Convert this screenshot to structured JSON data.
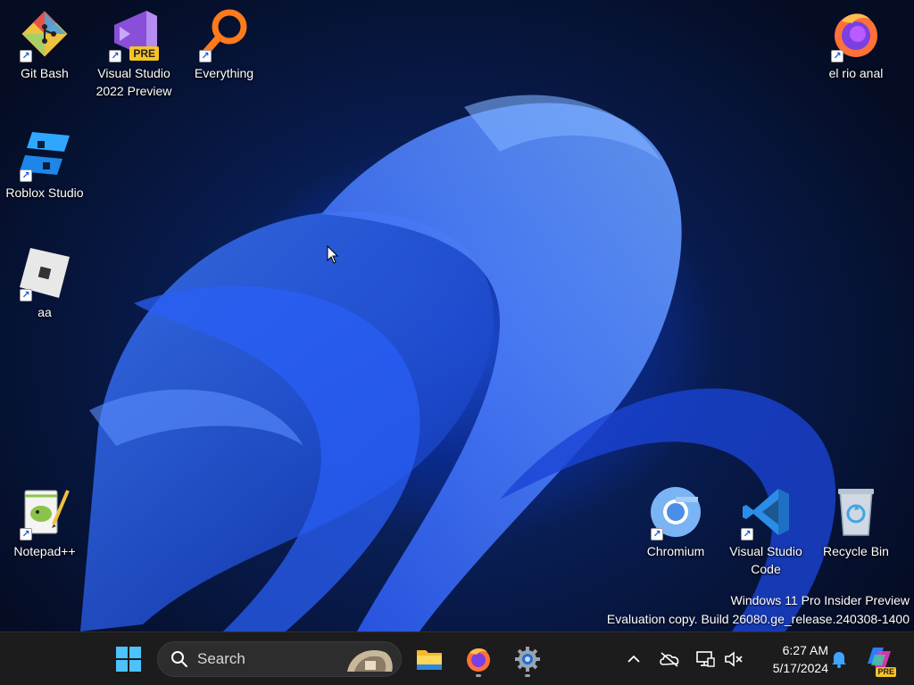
{
  "desktop": {
    "icons": [
      {
        "label": "Git Bash",
        "icon": "git-bash-icon"
      },
      {
        "label": "Visual Studio 2022 Preview",
        "icon": "visual-studio-icon",
        "badge": "PRE"
      },
      {
        "label": "Everything",
        "icon": "everything-search-icon"
      },
      {
        "label": "el rio anal",
        "icon": "firefox-icon"
      },
      {
        "label": "Roblox Studio",
        "icon": "roblox-studio-icon"
      },
      {
        "label": "aa",
        "icon": "roblox-icon"
      },
      {
        "label": "Notepad++",
        "icon": "notepad-plus-plus-icon"
      },
      {
        "label": "Chromium",
        "icon": "chromium-icon"
      },
      {
        "label": "Visual Studio Code",
        "icon": "vscode-icon"
      },
      {
        "label": "Recycle Bin",
        "icon": "recycle-bin-icon"
      }
    ]
  },
  "watermark": {
    "line1": "Windows 11 Pro Insider Preview",
    "line2": "Evaluation copy. Build 26080.ge_release.240308-1400"
  },
  "taskbar": {
    "search_placeholder": "Search",
    "pinned": [
      {
        "name": "start",
        "icon": "windows-logo-icon"
      },
      {
        "name": "file-explorer",
        "icon": "folder-icon"
      },
      {
        "name": "firefox",
        "icon": "firefox-icon",
        "running": true
      },
      {
        "name": "settings",
        "icon": "gear-icon",
        "running": true
      }
    ],
    "tray": {
      "icons": [
        "chevron-up-icon",
        "onedrive-offline-icon",
        "network-icon",
        "speaker-muted-icon"
      ],
      "time": "6:27 AM",
      "date": "5/17/2024",
      "copilot_badge": "PRE"
    }
  },
  "colors": {
    "taskbar_bg": "#1c1c1c",
    "wallpaper_accent": "#1d4ad0"
  }
}
